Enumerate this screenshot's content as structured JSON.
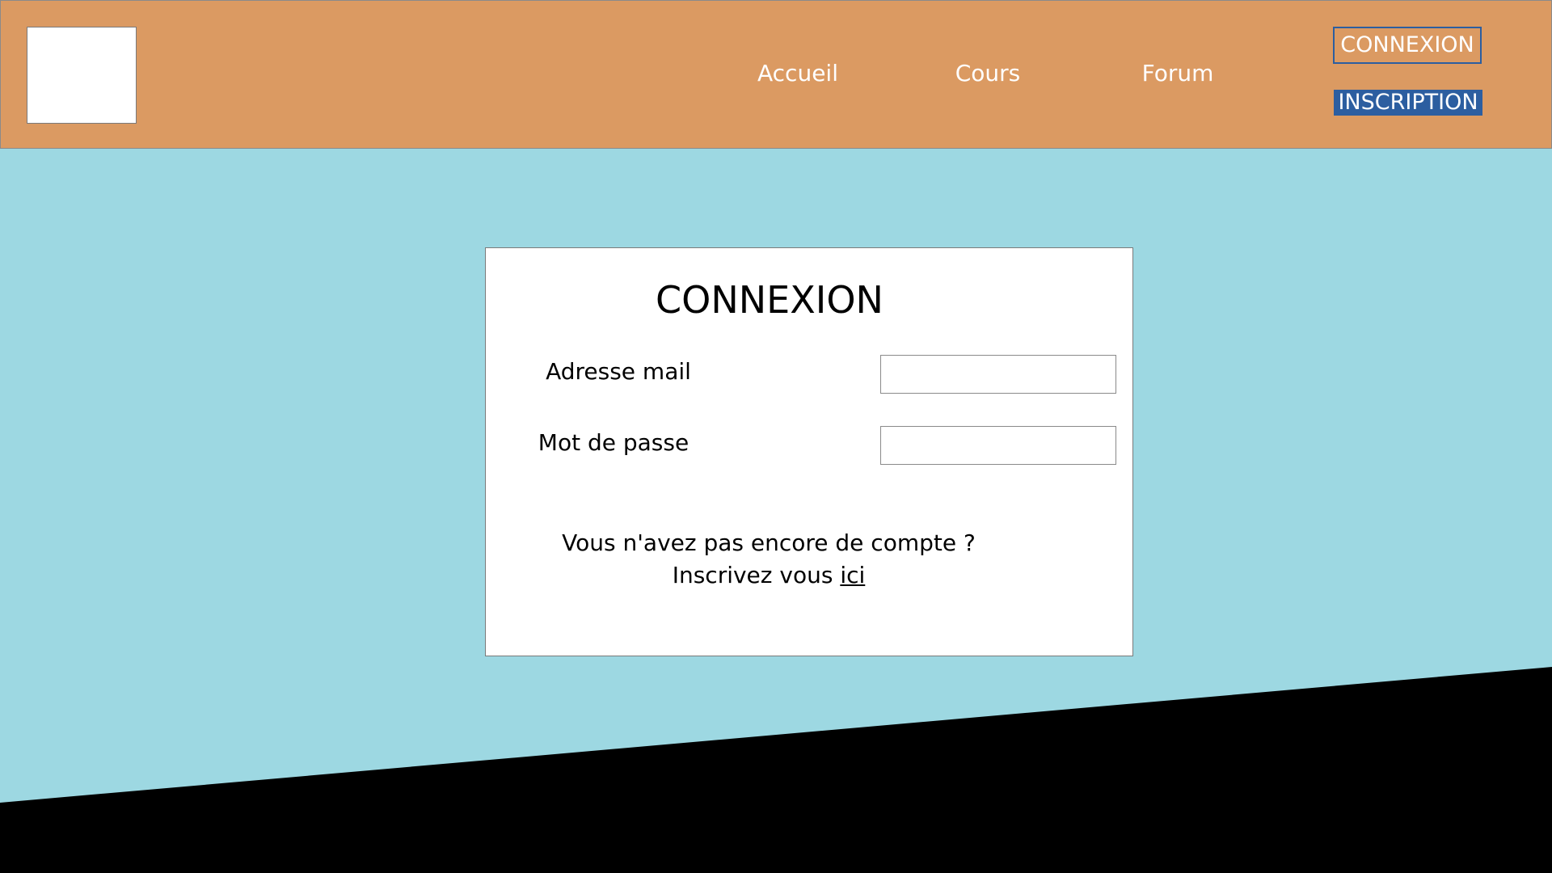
{
  "header": {
    "nav": {
      "accueil": "Accueil",
      "cours": "Cours",
      "forum": "Forum"
    },
    "connexion_button": "CONNEXION",
    "inscription_button": "INSCRIPTION"
  },
  "login_form": {
    "title": "CONNEXION",
    "email_label": "Adresse mail",
    "email_value": "",
    "password_label": "Mot de passe",
    "password_value": "",
    "no_account_text": "Vous n'avez pas encore de compte ?",
    "signup_prefix": "Inscrivez vous",
    "signup_link": "ici"
  },
  "colors": {
    "header_bg": "#db9a62",
    "page_bg": "#9dd8e2",
    "accent_blue": "#2c5ea0",
    "footer_band": "#000000"
  }
}
